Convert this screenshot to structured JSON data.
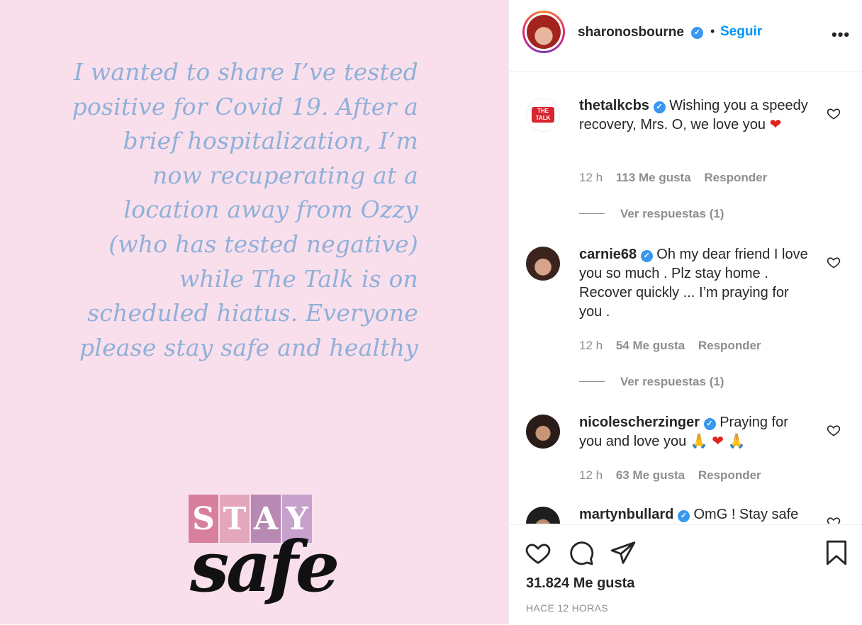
{
  "post": {
    "text_lines": [
      "I wanted to share I’ve tested",
      "positive for Covid 19. After a",
      "brief hospitalization, I’m",
      "now recuperating at a",
      "location away from Ozzy",
      "(who has tested negative)",
      "while The Talk is on",
      "scheduled hiatus. Everyone",
      "please stay safe and healthy"
    ],
    "stay_letters": [
      "S",
      "T",
      "A",
      "Y"
    ],
    "stay_colors": [
      "#d77f9c",
      "#e4a6bb",
      "#b889b3",
      "#c6a1cc"
    ],
    "safe_word": "safe"
  },
  "header": {
    "username": "sharonosbourne",
    "separator": "•",
    "follow_label": "Seguir",
    "more_label": "•••"
  },
  "comments": [
    {
      "username": "thetalkcbs",
      "text": "Wishing you a speedy recovery, Mrs. O, we love you",
      "emoji": "❤",
      "time": "12 h",
      "likes": "113 Me gusta",
      "reply_label": "Responder",
      "replies_label": "Ver respuestas (1)",
      "avatar_text": "THE TALK"
    },
    {
      "username": "carnie68",
      "text": "Oh my dear friend I love you so much . Plz stay home . Recover quickly ... I’m praying for you .",
      "time": "12 h",
      "likes": "54 Me gusta",
      "reply_label": "Responder",
      "replies_label": "Ver respuestas (1)"
    },
    {
      "username": "nicolescherzinger",
      "text": "Praying for you and love you",
      "emoji_hand": "🙏",
      "emoji_heart": "❤",
      "time": "12 h",
      "likes": "63 Me gusta",
      "reply_label": "Responder"
    },
    {
      "username": "martynbullard",
      "text": "OmG ! Stay safe"
    }
  ],
  "footer": {
    "likes": "31.824 Me gusta",
    "time": "HACE 12 HORAS"
  },
  "colors": {
    "link_blue": "#0095f6",
    "verified_blue": "#3897f0",
    "muted_gray": "#8e8e8e",
    "image_bg": "#f9dfec",
    "image_text": "#8fb0d9",
    "heart_red": "#e0241d"
  },
  "icons": {
    "verified": "verified-badge-icon",
    "like": "heart-outline-icon",
    "comment": "speech-bubble-icon",
    "share": "paper-plane-icon",
    "save": "bookmark-icon",
    "more": "ellipsis-icon"
  }
}
